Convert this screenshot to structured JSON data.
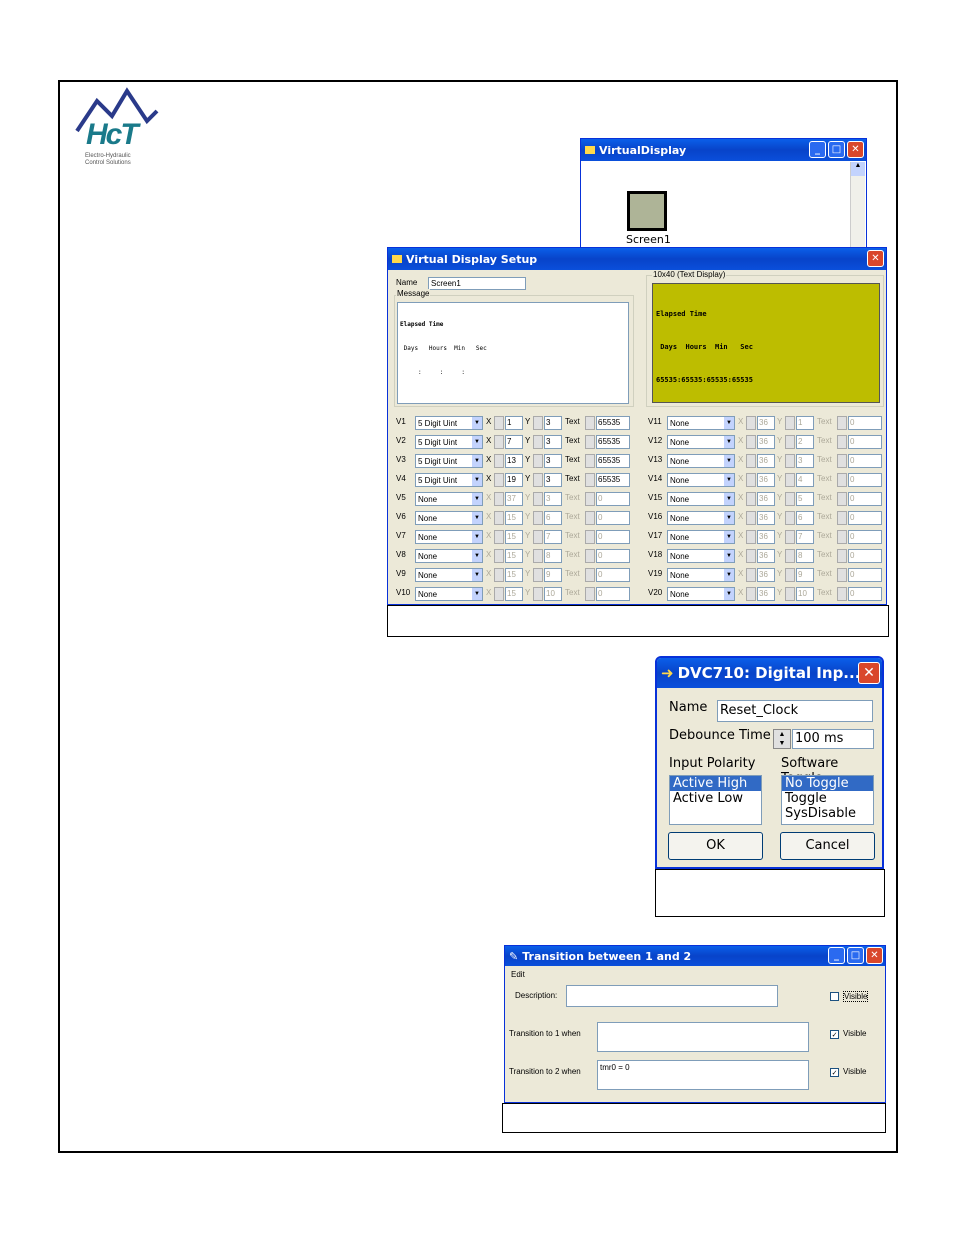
{
  "logo": {
    "text": "HcT",
    "subtitle_line1": "Electro-Hydraulic",
    "subtitle_line2": "Control Solutions"
  },
  "virtual_display": {
    "title": "VirtualDisplay",
    "screen_label": "Screen1"
  },
  "setup": {
    "title": "Virtual Display Setup",
    "name_label": "Name",
    "name_value": "Screen1",
    "message_legend": "Message",
    "message_line1": "Elapsed Time",
    "message_line2": " Days   Hours  Min   Sec",
    "message_line3": "     :     :     :",
    "display_legend": "10x40 (Text Display)",
    "display_line1": "Elapsed Time",
    "display_line2": " Days  Hours  Min   Sec",
    "display_line3": "65535:65535:65535:65535",
    "x_label": "X",
    "y_label": "Y",
    "text_label": "Text",
    "rows_left": [
      {
        "label": "V1",
        "type": "5 Digit Uint",
        "x": "1",
        "y": "3",
        "text": "65535",
        "enabled": true
      },
      {
        "label": "V2",
        "type": "5 Digit Uint",
        "x": "7",
        "y": "3",
        "text": "65535",
        "enabled": true
      },
      {
        "label": "V3",
        "type": "5 Digit Uint",
        "x": "13",
        "y": "3",
        "text": "65535",
        "enabled": true
      },
      {
        "label": "V4",
        "type": "5 Digit Uint",
        "x": "19",
        "y": "3",
        "text": "65535",
        "enabled": true
      },
      {
        "label": "V5",
        "type": "None",
        "x": "37",
        "y": "3",
        "text": "0",
        "enabled": false
      },
      {
        "label": "V6",
        "type": "None",
        "x": "15",
        "y": "6",
        "text": "0",
        "enabled": false
      },
      {
        "label": "V7",
        "type": "None",
        "x": "15",
        "y": "7",
        "text": "0",
        "enabled": false
      },
      {
        "label": "V8",
        "type": "None",
        "x": "15",
        "y": "8",
        "text": "0",
        "enabled": false
      },
      {
        "label": "V9",
        "type": "None",
        "x": "15",
        "y": "9",
        "text": "0",
        "enabled": false
      },
      {
        "label": "V10",
        "type": "None",
        "x": "15",
        "y": "10",
        "text": "0",
        "enabled": false
      }
    ],
    "rows_right": [
      {
        "label": "V11",
        "type": "None",
        "x": "36",
        "y": "1",
        "text": "0"
      },
      {
        "label": "V12",
        "type": "None",
        "x": "36",
        "y": "2",
        "text": "0"
      },
      {
        "label": "V13",
        "type": "None",
        "x": "36",
        "y": "3",
        "text": "0"
      },
      {
        "label": "V14",
        "type": "None",
        "x": "36",
        "y": "4",
        "text": "0"
      },
      {
        "label": "V15",
        "type": "None",
        "x": "36",
        "y": "5",
        "text": "0"
      },
      {
        "label": "V16",
        "type": "None",
        "x": "36",
        "y": "6",
        "text": "0"
      },
      {
        "label": "V17",
        "type": "None",
        "x": "36",
        "y": "7",
        "text": "0"
      },
      {
        "label": "V18",
        "type": "None",
        "x": "36",
        "y": "8",
        "text": "0"
      },
      {
        "label": "V19",
        "type": "None",
        "x": "36",
        "y": "9",
        "text": "0"
      },
      {
        "label": "V20",
        "type": "None",
        "x": "36",
        "y": "10",
        "text": "0"
      }
    ]
  },
  "digital_input": {
    "title": "DVC710: Digital Inp...",
    "name_label": "Name",
    "name_value": "Reset_Clock",
    "debounce_label": "Debounce Time",
    "debounce_value": "100 ms",
    "polarity_label": "Input Polarity",
    "polarity_options": [
      "Active High",
      "Active Low"
    ],
    "toggle_label": "Software Toggle",
    "toggle_options": [
      "No Toggle",
      "Toggle",
      "SysDisable"
    ],
    "ok_label": "OK",
    "cancel_label": "Cancel"
  },
  "transition": {
    "title": "Transition between 1 and 2",
    "menu_edit": "Edit",
    "description_label": "Description:",
    "to1_label": "Transition to 1 when",
    "to2_label": "Transition to 2 when",
    "to2_value": "tmr0 = 0",
    "visible_label": "Visible"
  },
  "colors": {
    "lcd": "#bdbd00",
    "titlebar": "#0a4fdb",
    "dialog_bg": "#ece9d8"
  }
}
